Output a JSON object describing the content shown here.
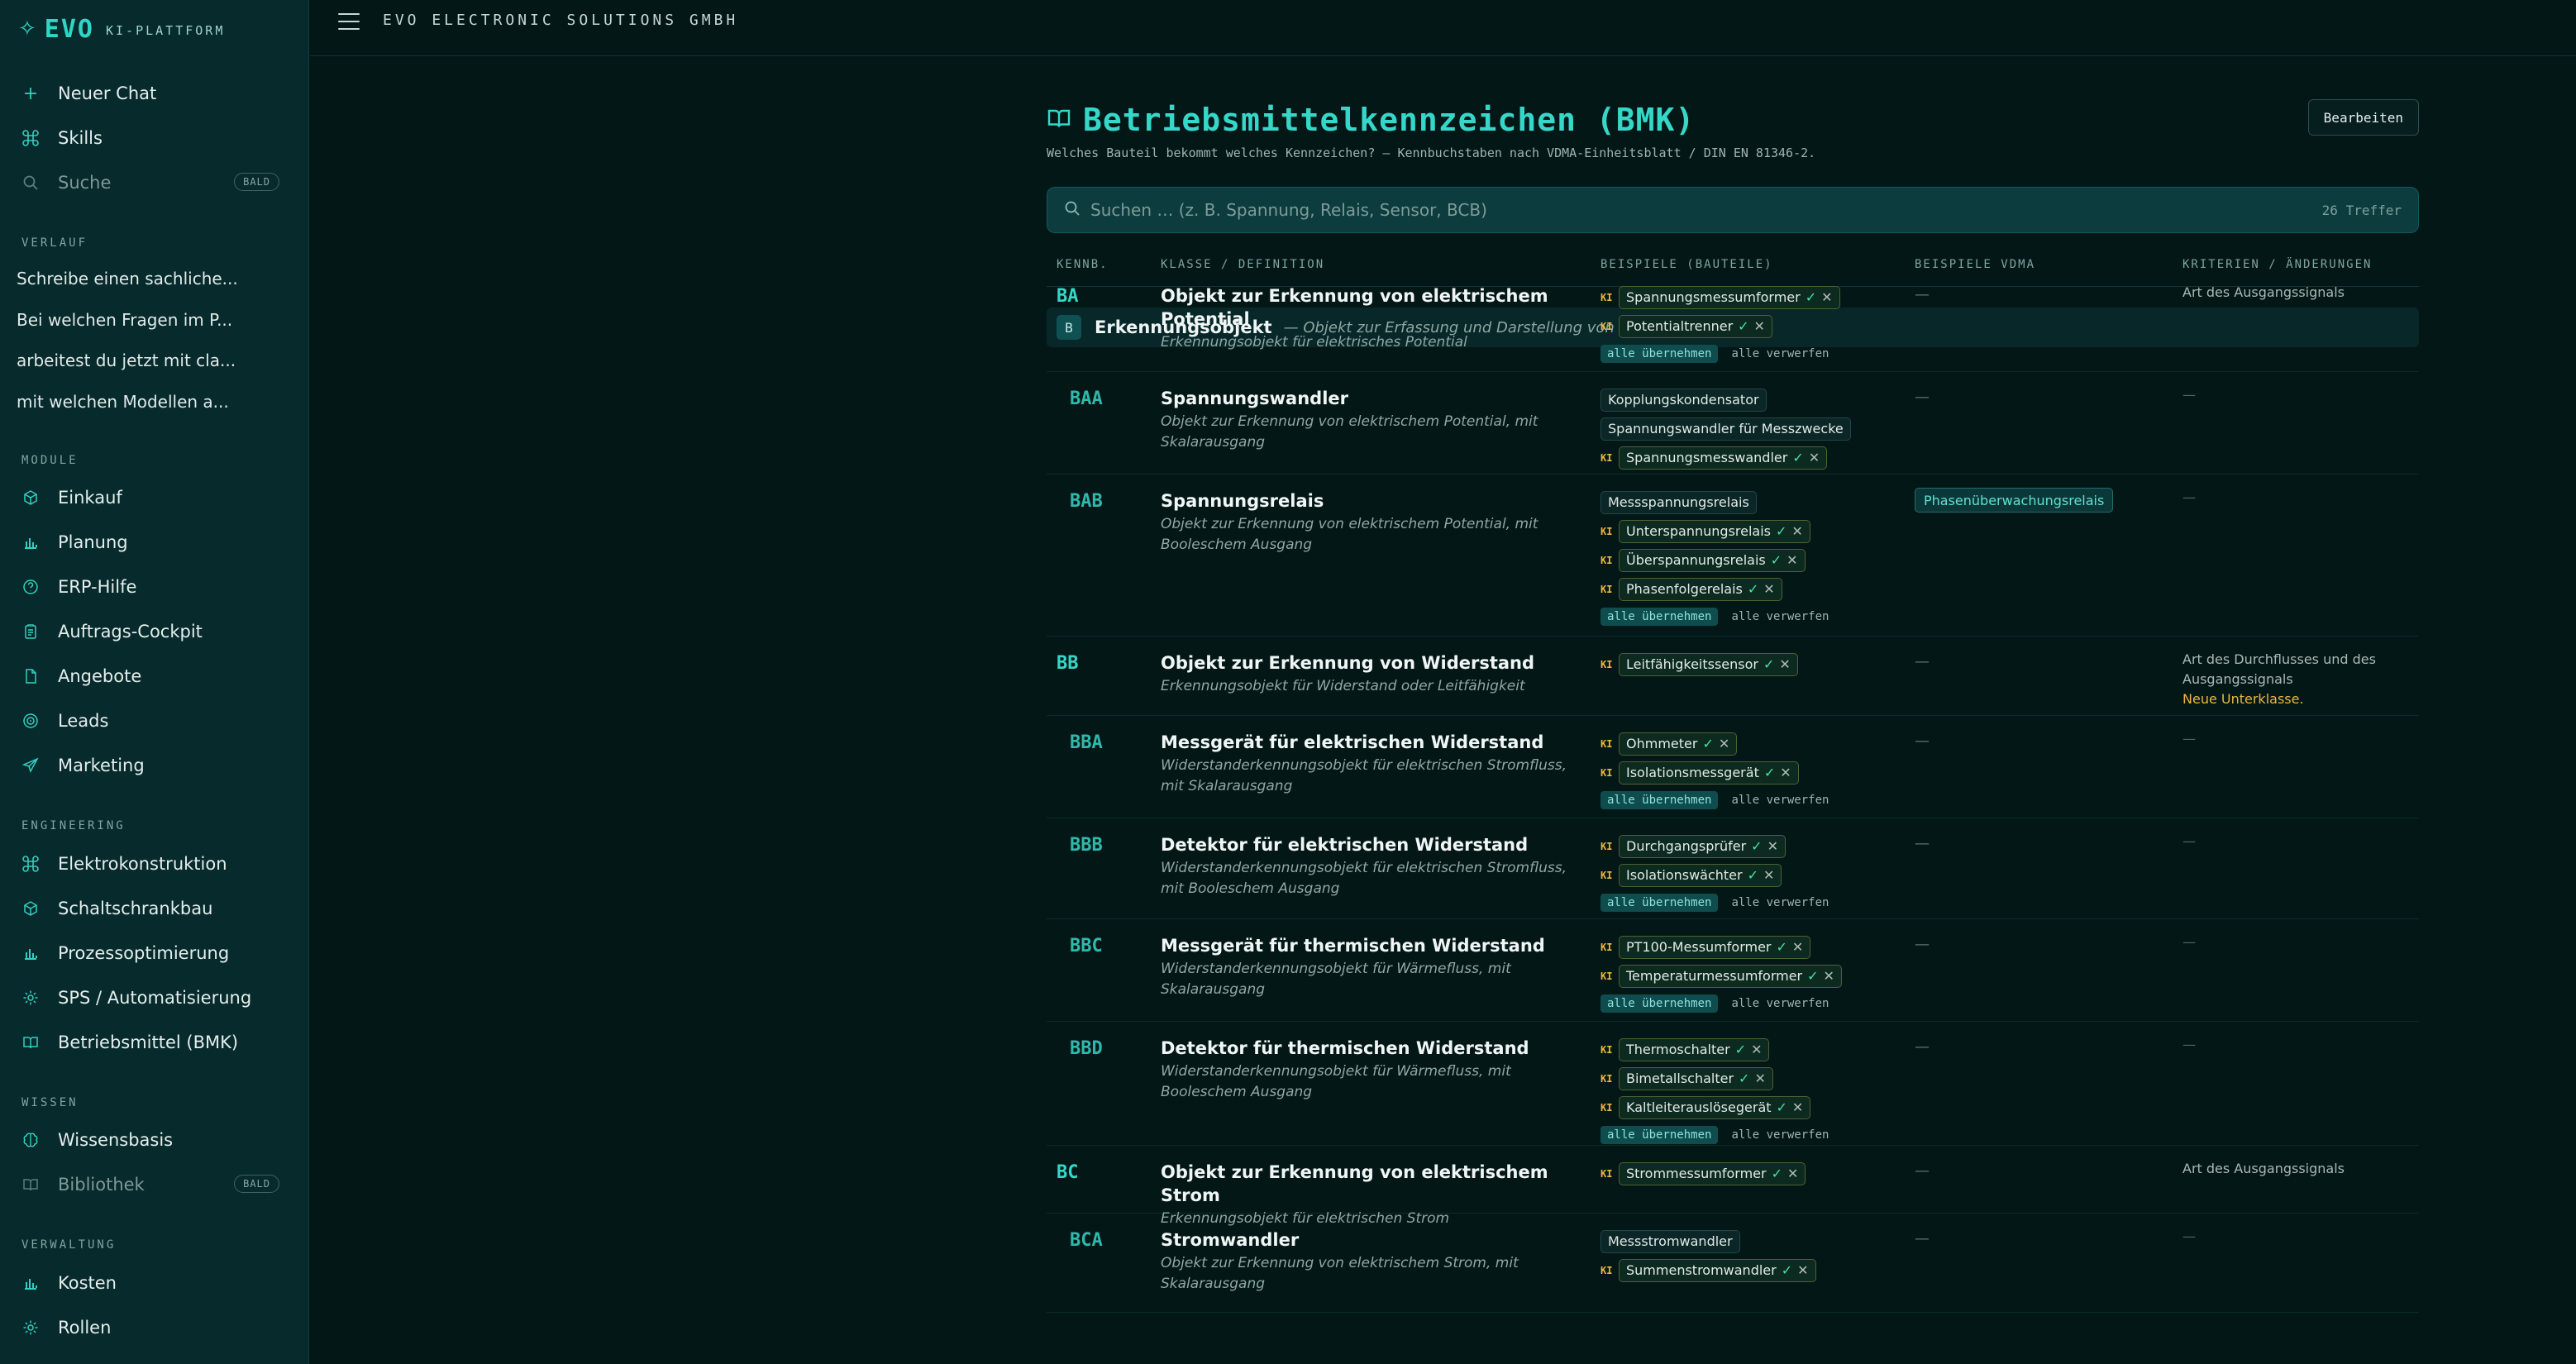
{
  "brand": {
    "name": "EVO",
    "sub": "KI-PLATTFORM"
  },
  "topbar": {
    "company": "EVO ELECTRONIC SOLUTIONS GMBH"
  },
  "sidebar": {
    "top": [
      {
        "label": "Neuer Chat",
        "icon": "plus-icon"
      },
      {
        "label": "Skills",
        "icon": "command-icon"
      },
      {
        "label": "Suche",
        "icon": "search-icon",
        "badge": "BALD"
      }
    ],
    "history_label": "VERLAUF",
    "history": [
      "Schreibe einen sachliche...",
      "Bei welchen Fragen im P...",
      "arbeitest du jetzt mit cla...",
      "mit welchen Modellen a..."
    ],
    "modules_label": "MODULE",
    "modules": [
      "Einkauf",
      "Planung",
      "ERP-Hilfe",
      "Auftrags-Cockpit",
      "Angebote",
      "Leads",
      "Marketing"
    ],
    "engineering_label": "ENGINEERING",
    "engineering": [
      "Elektrokonstruktion",
      "Schaltschrankbau",
      "Prozessoptimierung",
      "SPS / Automatisierung",
      "Betriebsmittel (BMK)"
    ],
    "wissen_label": "WISSEN",
    "wissen": [
      {
        "label": "Wissensbasis"
      },
      {
        "label": "Bibliothek",
        "badge": "BALD"
      }
    ],
    "verwaltung_label": "VERWALTUNG",
    "verwaltung": [
      "Kosten",
      "Rollen"
    ]
  },
  "main": {
    "title": "Betriebsmittelkennzeichen (BMK)",
    "edit_label": "Bearbeiten",
    "subtitle": "Welches Bauteil bekommt welches Kennzeichen? — Kennbuchstaben nach VDMA-Einheitsblatt / DIN EN 81346-2.",
    "search_placeholder": "Suchen … (z. B. Spannung, Relais, Sensor, BCB)",
    "hits": "26 Treffer",
    "headers": [
      "KENNB.",
      "KLASSE / DEFINITION",
      "BEISPIELE (BAUTEILE)",
      "BEISPIELE VDMA",
      "KRITERIEN / ÄNDERUNGEN"
    ],
    "group": {
      "code": "B",
      "name": "Erkennungsobjekt",
      "desc": "— Objekt zur Erfassung und Darstellung von Informationen"
    },
    "accept_all": "alle übernehmen",
    "reject_all": "alle verwerfen",
    "ki_label": "KI",
    "empty": "—"
  },
  "rows": [
    {
      "code": "BA",
      "name": "Objekt zur Erkennung von elektrischem Potential",
      "def": "Erkennungsobjekt für elektrisches Potential",
      "examples": [
        {
          "t": "Spannungsmessumformer",
          "ki": true
        },
        {
          "t": "Potentialtrenner",
          "ki": true
        }
      ],
      "vdma": "",
      "crit": "Art des Ausgangssignals"
    },
    {
      "code": "BAA",
      "name": "Spannungswandler",
      "def": "Objekt zur Erkennung von elektrischem Potential, mit Skalarausgang",
      "examples": [
        {
          "t": "Kopplungskondensator",
          "ki": false
        },
        {
          "t": "Spannungswandler für Messzwecke",
          "ki": false
        },
        {
          "t": "Spannungsmesswandler",
          "ki": true
        }
      ],
      "vdma": "",
      "crit": ""
    },
    {
      "code": "BAB",
      "name": "Spannungsrelais",
      "def": "Objekt zur Erkennung von elektrischem Potential, mit Booleschem Ausgang",
      "examples": [
        {
          "t": "Messspannungsrelais",
          "ki": false
        },
        {
          "t": "Unterspannungsrelais",
          "ki": true
        },
        {
          "t": "Überspannungsrelais",
          "ki": true
        },
        {
          "t": "Phasenfolgerelais",
          "ki": true
        }
      ],
      "vdma": "Phasenüberwachungsrelais",
      "crit": ""
    },
    {
      "code": "BB",
      "name": "Objekt zur Erkennung von Widerstand",
      "def": "Erkennungsobjekt für Widerstand oder Leitfähigkeit",
      "examples": [
        {
          "t": "Leitfähigkeitssensor",
          "ki": true
        }
      ],
      "vdma": "",
      "crit": "Art des Durchflusses und des Ausgangssignals",
      "crit_note": "Neue Unterklasse."
    },
    {
      "code": "BBA",
      "name": "Messgerät für elektrischen Widerstand",
      "def": "Widerstanderkennungsobjekt für elektrischen Stromfluss, mit Skalarausgang",
      "examples": [
        {
          "t": "Ohmmeter",
          "ki": true
        },
        {
          "t": "Isolationsmessgerät",
          "ki": true
        }
      ],
      "vdma": "",
      "crit": ""
    },
    {
      "code": "BBB",
      "name": "Detektor für elektrischen Widerstand",
      "def": "Widerstanderkennungsobjekt für elektrischen Stromfluss, mit Booleschem Ausgang",
      "examples": [
        {
          "t": "Durchgangsprüfer",
          "ki": true
        },
        {
          "t": "Isolationswächter",
          "ki": true
        }
      ],
      "vdma": "",
      "crit": ""
    },
    {
      "code": "BBC",
      "name": "Messgerät für thermischen Widerstand",
      "def": "Widerstanderkennungsobjekt für Wärmefluss, mit Skalarausgang",
      "examples": [
        {
          "t": "PT100-Messumformer",
          "ki": true
        },
        {
          "t": "Temperaturmessumformer",
          "ki": true
        }
      ],
      "vdma": "",
      "crit": ""
    },
    {
      "code": "BBD",
      "name": "Detektor für thermischen Widerstand",
      "def": "Widerstanderkennungsobjekt für Wärmefluss, mit Booleschem Ausgang",
      "examples": [
        {
          "t": "Thermoschalter",
          "ki": true
        },
        {
          "t": "Bimetallschalter",
          "ki": true
        },
        {
          "t": "Kaltleiterauslösegerät",
          "ki": true
        }
      ],
      "vdma": "",
      "crit": ""
    },
    {
      "code": "BC",
      "name": "Objekt zur Erkennung von elektrischem Strom",
      "def": "Erkennungsobjekt für elektrischen Strom",
      "examples": [
        {
          "t": "Strommessumformer",
          "ki": true
        }
      ],
      "vdma": "",
      "crit": "Art des Ausgangssignals"
    },
    {
      "code": "BCA",
      "name": "Stromwandler",
      "def": "Objekt zur Erkennung von elektrischem Strom, mit Skalarausgang",
      "examples": [
        {
          "t": "Messstromwandler",
          "ki": false
        },
        {
          "t": "Summenstromwandler",
          "ki": true
        }
      ],
      "vdma": "",
      "crit": ""
    }
  ]
}
